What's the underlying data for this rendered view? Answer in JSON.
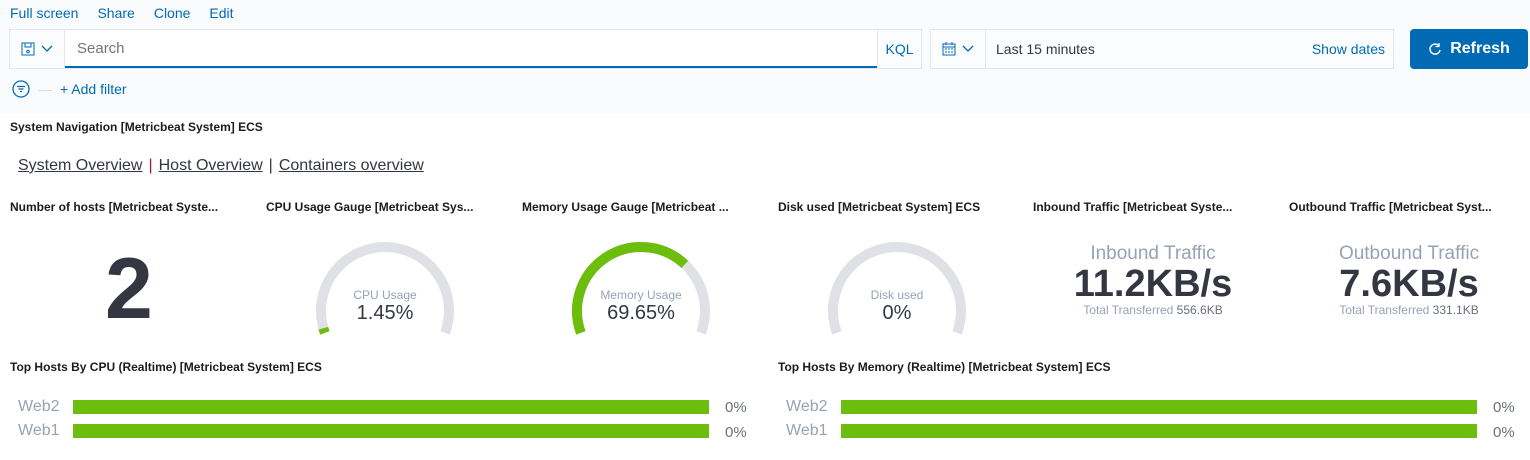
{
  "top_links": [
    "Full screen",
    "Share",
    "Clone",
    "Edit"
  ],
  "search": {
    "placeholder": "Search",
    "language": "KQL"
  },
  "date": {
    "range": "Last 15 minutes",
    "show_dates": "Show dates"
  },
  "refresh_label": "Refresh",
  "add_filter": "+ Add filter",
  "panels": {
    "nav_title": "System Navigation [Metricbeat System] ECS",
    "nav_links": [
      "System Overview",
      "Host Overview",
      "Containers overview"
    ],
    "hosts": {
      "title": "Number of hosts [Metricbeat Syste...",
      "value": "2"
    },
    "cpu": {
      "title": "CPU Usage Gauge [Metricbeat Sys...",
      "label": "CPU Usage",
      "value": "1.45%",
      "fraction": 0.0145
    },
    "memory": {
      "title": "Memory Usage Gauge [Metricbeat ...",
      "label": "Memory Usage",
      "value": "69.65%",
      "fraction": 0.6965
    },
    "disk": {
      "title": "Disk used [Metricbeat System] ECS",
      "label": "Disk used",
      "value": "0%",
      "fraction": 0
    },
    "inbound": {
      "title": "Inbound Traffic [Metricbeat Syste...",
      "label": "Inbound Traffic",
      "value": "11.2KB/s",
      "sub_label": "Total Transferred",
      "sub_value": "556.6KB"
    },
    "outbound": {
      "title": "Outbound Traffic [Metricbeat Syst...",
      "label": "Outbound Traffic",
      "value": "7.6KB/s",
      "sub_label": "Total Transferred",
      "sub_value": "331.1KB"
    },
    "top_cpu": {
      "title": "Top Hosts By CPU (Realtime) [Metricbeat System] ECS",
      "rows": [
        {
          "host": "Web2",
          "value": "0%"
        },
        {
          "host": "Web1",
          "value": "0%"
        }
      ]
    },
    "top_mem": {
      "title": "Top Hosts By Memory (Realtime) [Metricbeat System] ECS",
      "rows": [
        {
          "host": "Web2",
          "value": "0%"
        },
        {
          "host": "Web1",
          "value": "0%"
        }
      ]
    }
  },
  "colors": {
    "accent": "#006bb4",
    "gauge_fill": "#6dbe0c",
    "gauge_track": "#e0e1e6"
  }
}
